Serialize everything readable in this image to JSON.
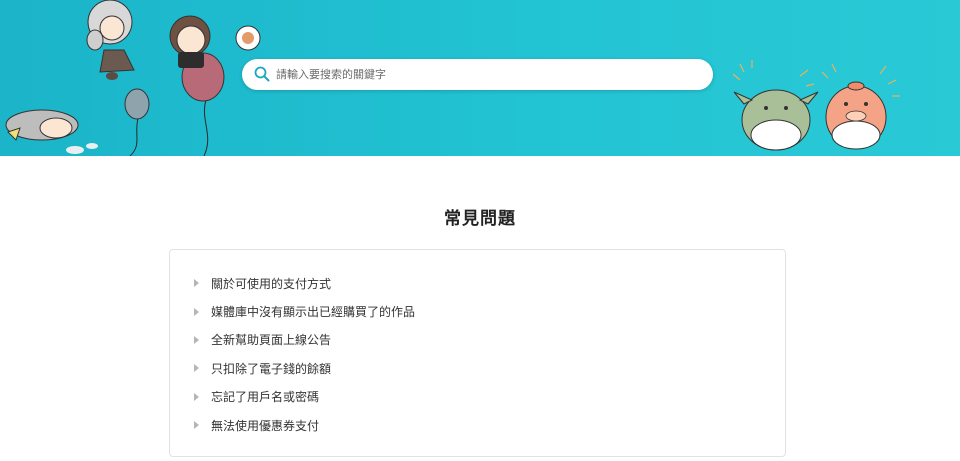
{
  "header": {
    "background_color": "#22c3d3",
    "illustrations": [
      "chibi-characters-with-balloons-art",
      "cheering-mascots-art"
    ]
  },
  "search": {
    "placeholder": "請輸入要搜索的關鍵字",
    "value": "",
    "icon": "search-icon"
  },
  "faq": {
    "title": "常見問題",
    "items": [
      {
        "label": "關於可使用的支付方式",
        "icon": "caret-right-icon"
      },
      {
        "label": "媒體庫中沒有顯示出已經購買了的作品",
        "icon": "caret-right-icon"
      },
      {
        "label": "全新幫助頁面上線公告",
        "icon": "caret-right-icon"
      },
      {
        "label": "只扣除了電子錢的餘額",
        "icon": "caret-right-icon"
      },
      {
        "label": "忘記了用戶名或密碼",
        "icon": "caret-right-icon"
      },
      {
        "label": "無法使用優惠券支付",
        "icon": "caret-right-icon"
      }
    ]
  }
}
